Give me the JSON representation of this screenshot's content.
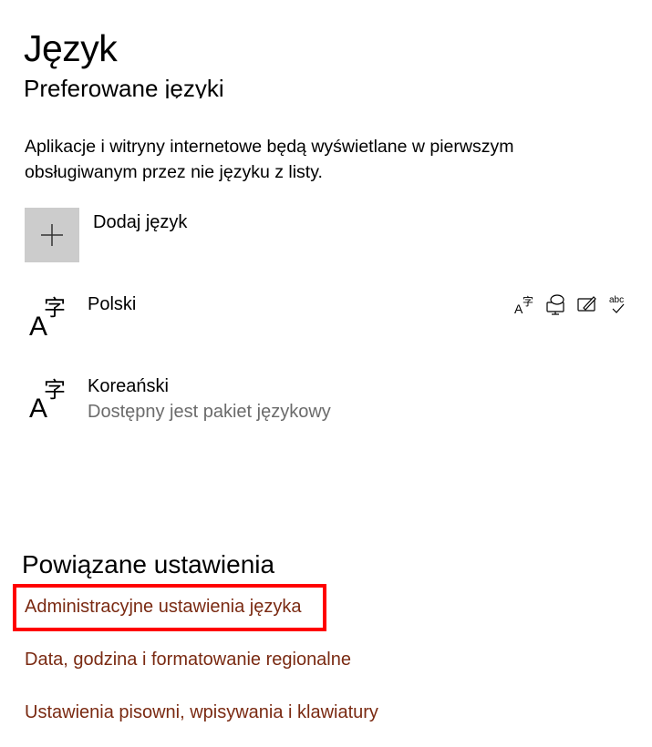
{
  "page": {
    "title": "Język"
  },
  "preferred": {
    "title": "Preferowane języki",
    "description": "Aplikacje i witryny internetowe będą wyświetlane w pierwszym obsługiwanym przez nie języku z listy.",
    "add_label": "Dodaj język",
    "languages": [
      {
        "name": "Polski",
        "status": "",
        "features": [
          "display-language-icon",
          "speech-icon",
          "handwriting-icon",
          "spellcheck-icon"
        ]
      },
      {
        "name": "Koreański",
        "status": "Dostępny jest pakiet językowy",
        "features": []
      }
    ]
  },
  "related": {
    "title": "Powiązane ustawienia",
    "links": [
      "Administracyjne ustawienia języka",
      "Data, godzina i formatowanie regionalne",
      "Ustawienia pisowni, wpisywania i klawiatury"
    ],
    "highlighted_link_index": 0
  },
  "colors": {
    "link": "#7a2a12",
    "highlight": "#ff0000",
    "secondary_text": "#6b6b6b",
    "add_box": "#cccccc"
  }
}
